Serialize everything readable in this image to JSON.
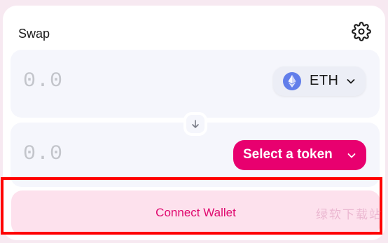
{
  "header": {
    "title": "Swap",
    "settings_icon": "gear-icon"
  },
  "input_panel": {
    "amount": "0.0",
    "token": {
      "symbol": "ETH",
      "icon": "eth-icon"
    }
  },
  "switch_icon": "arrow-down-icon",
  "output_panel": {
    "amount": "0.0",
    "select_label": "Select a token"
  },
  "connect_button": {
    "label": "Connect Wallet"
  },
  "watermark": "绿软下载站",
  "colors": {
    "accent": "#e8006f",
    "connect_bg": "#fde1ed",
    "connect_text": "#e0096f",
    "eth": "#627eea",
    "highlight": "#ff0000"
  }
}
